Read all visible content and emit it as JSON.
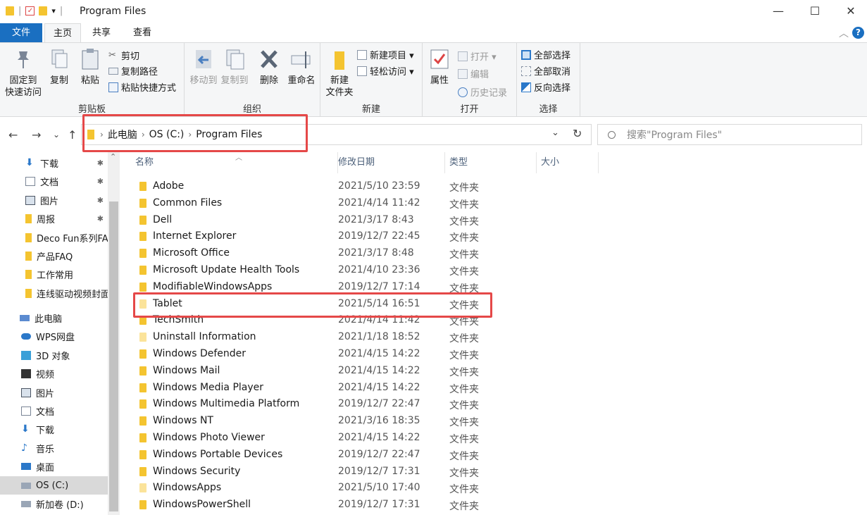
{
  "window": {
    "title": "Program Files",
    "quick_access_arrow": "▾",
    "minimize": "—",
    "maximize": "☐",
    "close": "✕"
  },
  "ribbon_tabs": {
    "file": "文件",
    "home": "主页",
    "share": "共享",
    "view": "查看",
    "help": "?"
  },
  "ribbon": {
    "clipboard": {
      "pin_to_quick_access": "固定到\n快速访问",
      "copy": "复制",
      "paste": "粘贴",
      "cut": "剪切",
      "copy_path": "复制路径",
      "paste_shortcut": "粘贴快捷方式",
      "group_label": "剪贴板"
    },
    "organize": {
      "move_to": "移动到",
      "copy_to": "复制到",
      "delete": "删除",
      "rename": "重命名",
      "group_label": "组织"
    },
    "new": {
      "new_folder": "新建\n文件夹",
      "new_item": "新建项目 ▾",
      "easy_access": "轻松访问 ▾",
      "group_label": "新建"
    },
    "open": {
      "properties": "属性",
      "open": "打开 ▾",
      "edit": "编辑",
      "history": "历史记录",
      "group_label": "打开"
    },
    "select": {
      "select_all": "全部选择",
      "select_none": "全部取消",
      "invert_selection": "反向选择",
      "group_label": "选择"
    }
  },
  "address": {
    "back": "←",
    "forward": "→",
    "recent": "⌄",
    "up": "↑",
    "crumbs": [
      "此电脑",
      "OS (C:)",
      "Program Files"
    ],
    "crumb_sep": "›",
    "dropdown": "⌄",
    "refresh": "↻",
    "search_placeholder": "搜索\"Program Files\""
  },
  "sidebar": {
    "items": [
      {
        "label": "下载",
        "icon": "download-icon",
        "pinned": true
      },
      {
        "label": "文档",
        "icon": "document-icon",
        "pinned": true
      },
      {
        "label": "图片",
        "icon": "picture-icon",
        "pinned": true
      },
      {
        "label": "周报",
        "icon": "folder-icon",
        "pinned": true
      },
      {
        "label": "Deco Fun系列FA",
        "icon": "folder-icon",
        "pinned": false
      },
      {
        "label": "产品FAQ",
        "icon": "folder-icon",
        "pinned": false
      },
      {
        "label": "工作常用",
        "icon": "folder-icon",
        "pinned": false
      },
      {
        "label": "连线驱动视频封面",
        "icon": "folder-icon",
        "pinned": false
      },
      {
        "label": "此电脑",
        "icon": "computer-icon",
        "pinned": false
      },
      {
        "label": "WPS网盘",
        "icon": "cloud-icon",
        "pinned": false
      },
      {
        "label": "3D 对象",
        "icon": "cube-icon",
        "pinned": false
      },
      {
        "label": "视频",
        "icon": "video-icon",
        "pinned": false
      },
      {
        "label": "图片",
        "icon": "picture-icon",
        "pinned": false
      },
      {
        "label": "文档",
        "icon": "document-icon",
        "pinned": false
      },
      {
        "label": "下载",
        "icon": "download-icon",
        "pinned": false
      },
      {
        "label": "音乐",
        "icon": "music-icon",
        "pinned": false
      },
      {
        "label": "桌面",
        "icon": "desktop-icon",
        "pinned": false
      },
      {
        "label": "OS (C:)",
        "icon": "drive-icon",
        "pinned": false
      },
      {
        "label": "新加卷 (D:)",
        "icon": "drive-icon",
        "pinned": false
      }
    ],
    "pin_glyph": "📌"
  },
  "columns": {
    "name": "名称",
    "date": "修改日期",
    "type": "类型",
    "size": "大小"
  },
  "files": [
    {
      "name": "Adobe",
      "date": "2021/5/10 23:59",
      "type": "文件夹"
    },
    {
      "name": "Common Files",
      "date": "2021/4/14 11:42",
      "type": "文件夹"
    },
    {
      "name": "Dell",
      "date": "2021/3/17 8:43",
      "type": "文件夹"
    },
    {
      "name": "Internet Explorer",
      "date": "2019/12/7 22:45",
      "type": "文件夹"
    },
    {
      "name": "Microsoft Office",
      "date": "2021/3/17 8:48",
      "type": "文件夹"
    },
    {
      "name": "Microsoft Update Health Tools",
      "date": "2021/4/10 23:36",
      "type": "文件夹"
    },
    {
      "name": "ModifiableWindowsApps",
      "date": "2019/12/7 17:14",
      "type": "文件夹"
    },
    {
      "name": "Tablet",
      "date": "2021/5/14 16:51",
      "type": "文件夹"
    },
    {
      "name": "TechSmith",
      "date": "2021/4/14 11:42",
      "type": "文件夹"
    },
    {
      "name": "Uninstall Information",
      "date": "2021/1/18 18:52",
      "type": "文件夹"
    },
    {
      "name": "Windows Defender",
      "date": "2021/4/15 14:22",
      "type": "文件夹"
    },
    {
      "name": "Windows Mail",
      "date": "2021/4/15 14:22",
      "type": "文件夹"
    },
    {
      "name": "Windows Media Player",
      "date": "2021/4/15 14:22",
      "type": "文件夹"
    },
    {
      "name": "Windows Multimedia Platform",
      "date": "2019/12/7 22:47",
      "type": "文件夹"
    },
    {
      "name": "Windows NT",
      "date": "2021/3/16 18:35",
      "type": "文件夹"
    },
    {
      "name": "Windows Photo Viewer",
      "date": "2021/4/15 14:22",
      "type": "文件夹"
    },
    {
      "name": "Windows Portable Devices",
      "date": "2019/12/7 22:47",
      "type": "文件夹"
    },
    {
      "name": "Windows Security",
      "date": "2019/12/7 17:31",
      "type": "文件夹"
    },
    {
      "name": "WindowsApps",
      "date": "2021/5/10 17:40",
      "type": "文件夹"
    },
    {
      "name": "WindowsPowerShell",
      "date": "2019/12/7 17:31",
      "type": "文件夹"
    }
  ],
  "colors": {
    "accent": "#1a6fc1",
    "folder": "#f4c430",
    "highlight": "#e54848"
  }
}
